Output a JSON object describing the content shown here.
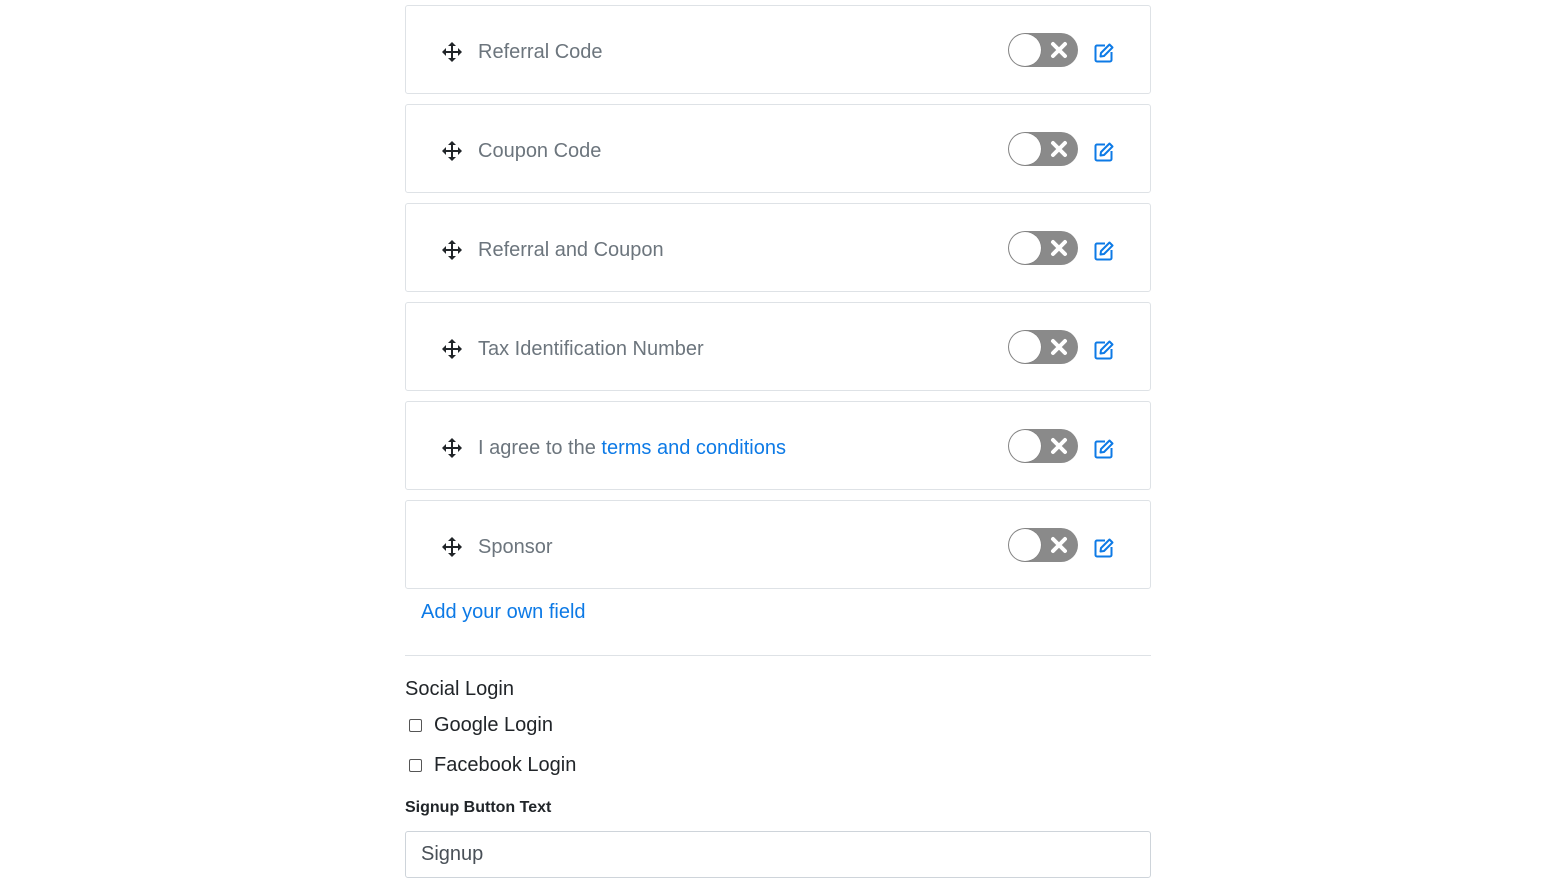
{
  "fields": [
    {
      "label": "Referral Code",
      "enabled": false
    },
    {
      "label": "Coupon Code",
      "enabled": false
    },
    {
      "label": "Referral and Coupon",
      "enabled": false
    },
    {
      "label": "Tax Identification Number",
      "enabled": false
    },
    {
      "label_prefix": "I agree to the ",
      "link_text": "terms and conditions",
      "enabled": false
    },
    {
      "label": "Sponsor",
      "enabled": false
    }
  ],
  "add_field_link": "Add your own field",
  "social_login": {
    "title": "Social Login",
    "options": [
      {
        "label": "Google Login",
        "checked": false
      },
      {
        "label": "Facebook Login",
        "checked": false
      }
    ]
  },
  "signup_button_text": {
    "label": "Signup Button Text",
    "value": "Signup"
  },
  "colors": {
    "link": "#0d7ae6",
    "toggle_off": "#8a8a8a",
    "label_muted": "#6c757d"
  },
  "icons": {
    "drag": "move-arrows-icon",
    "toggle_off": "x-icon",
    "edit": "edit-icon"
  }
}
